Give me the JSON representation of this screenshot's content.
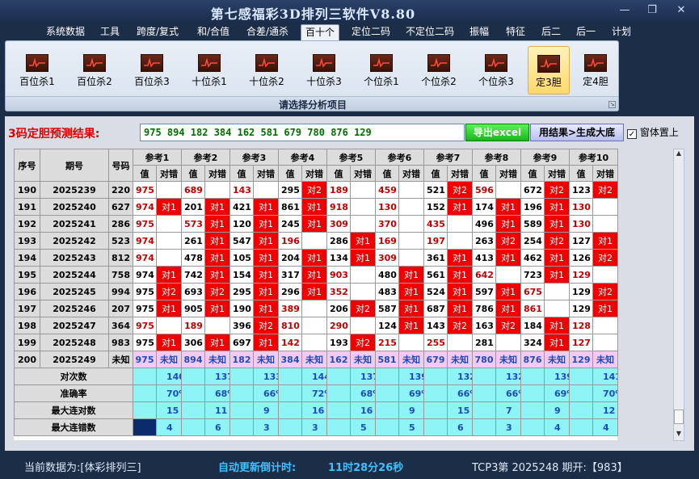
{
  "window": {
    "title": "第七感福彩3D排列三软件V8.80",
    "controls": [
      "—",
      "❐",
      "✕"
    ]
  },
  "menu": [
    "系统数据",
    "工具",
    "跨度/复式",
    "和/合值",
    "合差/通杀",
    "百十个",
    "定位二码",
    "不定位二码",
    "振幅",
    "特征",
    "后二",
    "后一",
    "计划"
  ],
  "menu_active": "百十个",
  "ribbon": {
    "buttons": [
      "百位杀1",
      "百位杀2",
      "百位杀3",
      "十位杀1",
      "十位杀2",
      "十位杀3",
      "个位杀1",
      "个位杀2",
      "个位杀3",
      "定3胆",
      "定4胆"
    ],
    "selected": "定3胆",
    "group_label": "请选择分析项目"
  },
  "prediction": {
    "label": "3码定胆预测结果:",
    "value": "975  894  182  384  162  581  679  780  876  129",
    "export_button": "导出excel",
    "enlarge_button": "用结果>生成大底",
    "topmost_label": "窗体置上",
    "topmost_checked": true
  },
  "table": {
    "col_seq": "序号",
    "col_issue": "期号",
    "col_num": "号码",
    "ref_groups": [
      "参考1",
      "参考2",
      "参考3",
      "参考4",
      "参考5",
      "参考6",
      "参考7",
      "参考8",
      "参考9",
      "参考10"
    ],
    "sub_val": "值",
    "sub_hit": "对错",
    "hit_word": "对",
    "rows": [
      {
        "seq": "190",
        "issue": "2025239",
        "num": "220",
        "vals": [
          "975",
          "689",
          "143",
          "295",
          "189",
          "459",
          "521",
          "596",
          "672",
          "123"
        ],
        "hits": [
          "",
          "",
          "",
          "对2",
          "",
          "",
          "对2",
          "",
          "对2",
          "对2"
        ],
        "red": [
          1,
          1,
          1,
          0,
          1,
          1,
          0,
          1,
          0,
          0
        ]
      },
      {
        "seq": "191",
        "issue": "2025240",
        "num": "627",
        "vals": [
          "974",
          "201",
          "421",
          "861",
          "918",
          "130",
          "152",
          "174",
          "196",
          "130"
        ],
        "hits": [
          "对1",
          "对1",
          "对1",
          "对1",
          "",
          "",
          "对1",
          "对1",
          "对1",
          ""
        ],
        "red": [
          1,
          0,
          0,
          0,
          1,
          1,
          0,
          0,
          0,
          1
        ]
      },
      {
        "seq": "192",
        "issue": "2025241",
        "num": "286",
        "vals": [
          "975",
          "573",
          "120",
          "245",
          "309",
          "370",
          "435",
          "496",
          "589",
          "130"
        ],
        "hits": [
          "",
          "对1",
          "对1",
          "对1",
          "",
          "",
          "",
          "对1",
          "对1",
          ""
        ],
        "red": [
          1,
          1,
          0,
          0,
          1,
          1,
          1,
          0,
          0,
          1
        ]
      },
      {
        "seq": "193",
        "issue": "2025242",
        "num": "523",
        "vals": [
          "974",
          "261",
          "547",
          "196",
          "286",
          "169",
          "197",
          "263",
          "254",
          "127"
        ],
        "hits": [
          "",
          "对1",
          "对1",
          "",
          "对1",
          "",
          "",
          "对2",
          "对2",
          "对1"
        ],
        "red": [
          1,
          0,
          0,
          1,
          0,
          1,
          1,
          0,
          0,
          0
        ]
      },
      {
        "seq": "194",
        "issue": "2025243",
        "num": "812",
        "vals": [
          "974",
          "478",
          "105",
          "204",
          "134",
          "309",
          "361",
          "413",
          "462",
          "126"
        ],
        "hits": [
          "",
          "对1",
          "对1",
          "对1",
          "对1",
          "",
          "对1",
          "对1",
          "对1",
          "对2"
        ],
        "red": [
          1,
          0,
          0,
          0,
          0,
          1,
          0,
          0,
          0,
          0
        ]
      },
      {
        "seq": "195",
        "issue": "2025244",
        "num": "758",
        "vals": [
          "974",
          "742",
          "154",
          "317",
          "903",
          "480",
          "561",
          "642",
          "723",
          "129"
        ],
        "hits": [
          "对1",
          "对1",
          "对1",
          "对1",
          "",
          "对1",
          "对1",
          "",
          "对1",
          ""
        ],
        "red": [
          0,
          0,
          0,
          0,
          1,
          0,
          0,
          1,
          0,
          1
        ]
      },
      {
        "seq": "196",
        "issue": "2025245",
        "num": "994",
        "vals": [
          "975",
          "693",
          "295",
          "296",
          "352",
          "483",
          "524",
          "597",
          "675",
          "129"
        ],
        "hits": [
          "对2",
          "对2",
          "对1",
          "对1",
          "",
          "对1",
          "对1",
          "对1",
          "",
          "对2"
        ],
        "red": [
          0,
          0,
          0,
          0,
          1,
          0,
          0,
          0,
          1,
          0
        ]
      },
      {
        "seq": "197",
        "issue": "2025246",
        "num": "207",
        "vals": [
          "975",
          "905",
          "190",
          "389",
          "206",
          "587",
          "687",
          "786",
          "861",
          "129"
        ],
        "hits": [
          "对1",
          "对1",
          "对1",
          "",
          "对2",
          "对1",
          "对1",
          "对1",
          "",
          "对1"
        ],
        "red": [
          0,
          0,
          0,
          1,
          0,
          0,
          0,
          0,
          1,
          0
        ]
      },
      {
        "seq": "198",
        "issue": "2025247",
        "num": "364",
        "vals": [
          "975",
          "189",
          "396",
          "810",
          "290",
          "124",
          "143",
          "163",
          "184",
          "128"
        ],
        "hits": [
          "",
          "",
          "对2",
          "",
          "",
          "对1",
          "对2",
          "对2",
          "对1",
          ""
        ],
        "red": [
          1,
          1,
          0,
          1,
          1,
          0,
          0,
          0,
          0,
          1
        ]
      },
      {
        "seq": "199",
        "issue": "2025248",
        "num": "983",
        "vals": [
          "975",
          "306",
          "697",
          "142",
          "193",
          "215",
          "255",
          "281",
          "324",
          "127"
        ],
        "hits": [
          "对1",
          "对1",
          "对1",
          "",
          "对2",
          "",
          "",
          "",
          "对1",
          ""
        ],
        "red": [
          0,
          0,
          0,
          1,
          0,
          1,
          1,
          0,
          0,
          1
        ]
      }
    ],
    "pred_row": {
      "seq": "200",
      "issue": "2025249",
      "num": "未知",
      "vals": [
        "975",
        "894",
        "182",
        "384",
        "162",
        "581",
        "679",
        "780",
        "876",
        "129"
      ],
      "hit": "未知"
    },
    "stats": [
      {
        "label": "对次数",
        "values": [
          "140",
          "137",
          "133",
          "144",
          "137",
          "139",
          "132",
          "132",
          "139",
          "141"
        ]
      },
      {
        "label": "准确率",
        "values": [
          "70%",
          "68%",
          "66%",
          "72%",
          "68%",
          "69%",
          "66%",
          "66%",
          "69%",
          "70%"
        ]
      },
      {
        "label": "最大连对数",
        "values": [
          "15",
          "11",
          "9",
          "16",
          "16",
          "9",
          "15",
          "7",
          "9",
          "12"
        ]
      },
      {
        "label": "最大连错数",
        "values": [
          "4",
          "6",
          "3",
          "3",
          "5",
          "5",
          "6",
          "3",
          "4",
          "4"
        ]
      }
    ]
  },
  "status": {
    "data_source": "当前数据为:[体彩排列三]",
    "countdown_label": "自动更新倒计时:",
    "countdown_value": "11时28分26秒",
    "issue_info": "TCP3第 2025248 期开:【983】"
  },
  "colors": {
    "hit_red": "#f00000",
    "stat_cyan": "#8ff4f6",
    "pred_pink": "#f4c9f2",
    "title_bg": "#1c2d48"
  }
}
